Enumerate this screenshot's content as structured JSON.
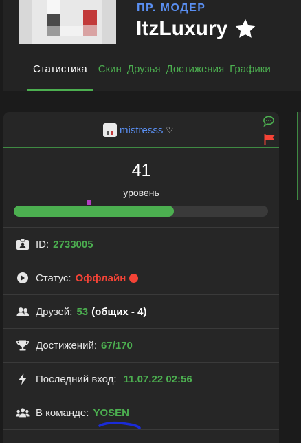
{
  "profile": {
    "rank": "ПР. МОДЕР",
    "nickname": "ItzLuxury",
    "card_name": "mistresss"
  },
  "tabs": [
    {
      "label": "Статистика",
      "active": true
    },
    {
      "label": "Скин"
    },
    {
      "label": "Друзья"
    },
    {
      "label": "Достижения"
    },
    {
      "label": "Графики"
    }
  ],
  "level": {
    "value": "41",
    "label": "уровень",
    "progress_fraction": 0.63
  },
  "stats": {
    "id_label": "ID:",
    "id_value": "2733005",
    "status_label": "Статус:",
    "status_value": "Оффлайн",
    "friends_label": "Друзей:",
    "friends_value": "53",
    "friends_common": "(общих - 4)",
    "achievements_label": "Достижений:",
    "achievements_value": "67/170",
    "last_login_label": "Последний вход:",
    "last_login_value": "11.07.22 02:56",
    "team_label": "В команде:",
    "team_value": "YOSEN"
  },
  "colors": {
    "accent_green": "#4caf50",
    "rank_blue": "#5a8ff2",
    "offline_red": "#f44336"
  }
}
